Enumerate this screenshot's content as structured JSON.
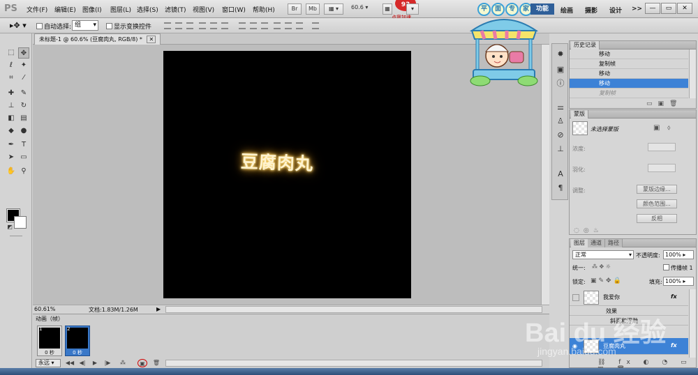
{
  "app": {
    "logo": "PS",
    "menu": [
      "文件(F)",
      "编辑(E)",
      "图像(I)",
      "图层(L)",
      "选择(S)",
      "滤镜(T)",
      "视图(V)",
      "窗口(W)",
      "帮助(H)"
    ],
    "mini_buttons": [
      "Br",
      "Mb"
    ],
    "zoom": "60.6",
    "badge_number": "93",
    "badge_caption": "点我加速",
    "workspace_circles": [
      "平",
      "面",
      "专",
      "家"
    ],
    "workspace_active": "功能",
    "workspace_tabs": [
      "绘画",
      "摄影",
      "设计",
      ">>"
    ],
    "window_buttons": [
      "—",
      "▭",
      "✕"
    ]
  },
  "options": {
    "auto_select_label": "自动选择:",
    "auto_select_value": "组",
    "show_transform_label": "显示变换控件"
  },
  "document": {
    "tab_title": "未标题-1 @ 60.6% (豆腐肉丸, RGB/8) *",
    "canvas_text": "豆腐肉丸",
    "canvas_color": "#000000",
    "status_zoom": "60.61%",
    "status_doc": "文档:1.83M/1.26M"
  },
  "animation": {
    "title": "动画（帧）",
    "frames": [
      {
        "num": "1",
        "delay": "0 秒"
      },
      {
        "num": "2",
        "delay": "0 秒"
      }
    ],
    "loop": "永远",
    "controls": [
      "◀◀",
      "◀|",
      "▶",
      "|▶",
      "⁂",
      "▣",
      "🗑"
    ]
  },
  "history": {
    "title": "历史记录",
    "items": [
      "移动",
      "复制帧",
      "移动",
      "移动",
      "复制帧"
    ]
  },
  "masks": {
    "title": "蒙版",
    "no_mask": "未选择蒙版",
    "density": "浓度:",
    "feather": "羽化:",
    "adjust": "调整:",
    "buttons": [
      "蒙版边缘...",
      "颜色范围...",
      "反相"
    ]
  },
  "layers": {
    "tabs": [
      "图层",
      "通道",
      "路径"
    ],
    "blend_mode": "正常",
    "opacity_label": "不透明度:",
    "opacity": "100%",
    "unify_label": "统一:",
    "propagate_label": "传播帧 1",
    "lock_label": "锁定:",
    "fill_label": "填充:",
    "fill": "100%",
    "items": [
      {
        "name": "我爱你",
        "fx": "fx"
      },
      {
        "name": "效果",
        "fx": ""
      },
      {
        "name": "斜面和浮雕",
        "fx": ""
      },
      {
        "name": "豆腐肉丸",
        "fx": "fx"
      }
    ]
  },
  "watermark": {
    "brand": "Bai du 经验",
    "url": "jingyan.baidu.com"
  }
}
